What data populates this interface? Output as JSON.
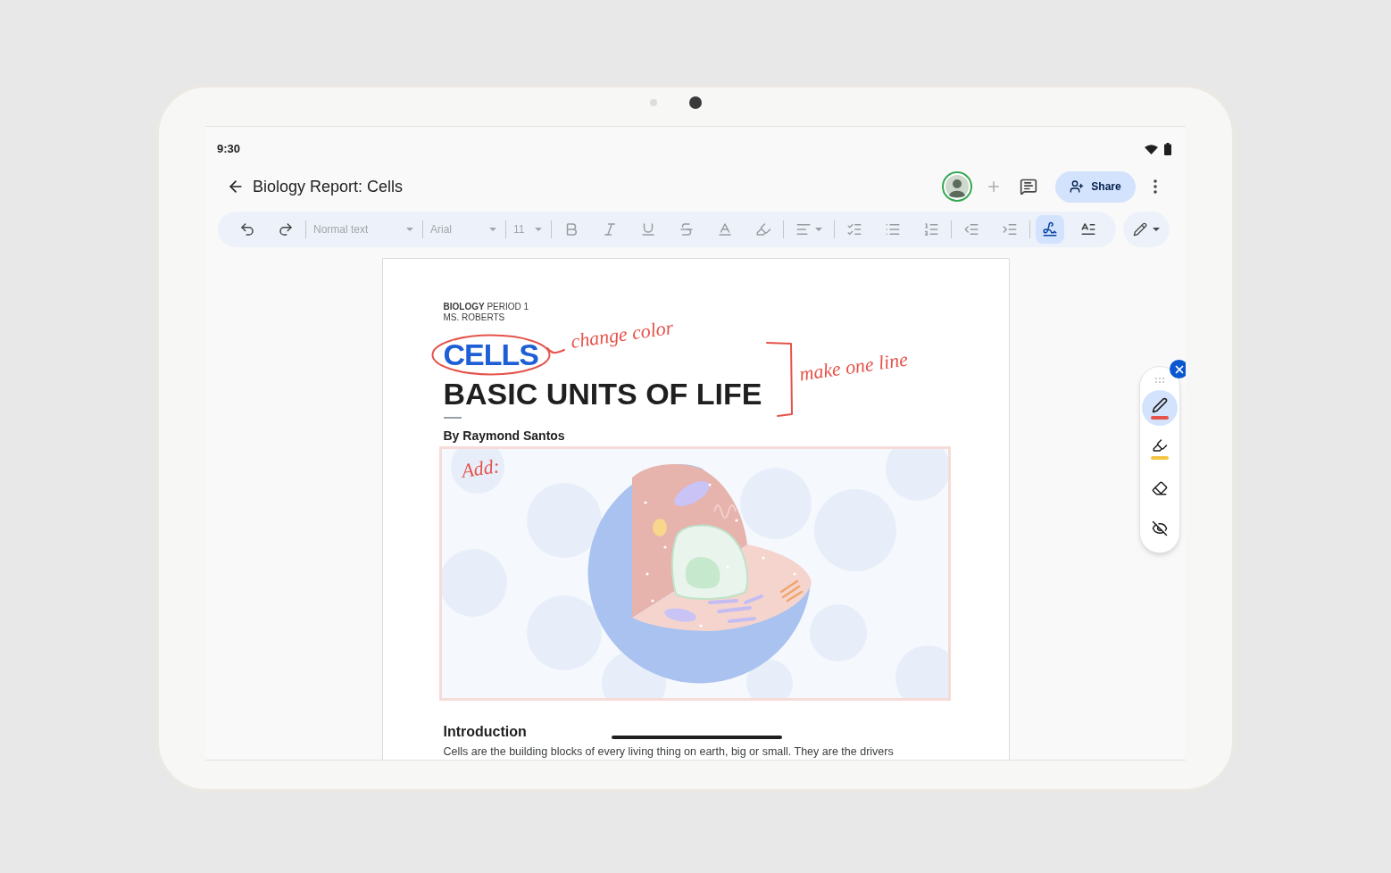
{
  "status_bar": {
    "time": "9:30"
  },
  "app_bar": {
    "title": "Biology Report: Cells",
    "share": "Share"
  },
  "toolbar": {
    "groups": [
      [
        {
          "kind": "undo",
          "disabled": false
        },
        {
          "kind": "redo",
          "disabled": false
        }
      ],
      [
        {
          "kind": "dropdown",
          "label": "Normal text",
          "disabled": true
        }
      ],
      [
        {
          "kind": "dropdown",
          "label": "Arial",
          "disabled": true
        }
      ],
      [
        {
          "kind": "dropdown",
          "label": "11",
          "disabled": true
        }
      ],
      [
        {
          "kind": "bold",
          "disabled": true
        },
        {
          "kind": "italic",
          "disabled": true
        },
        {
          "kind": "underline",
          "disabled": true
        },
        {
          "kind": "strikethrough",
          "disabled": true
        },
        {
          "kind": "text_color",
          "disabled": true
        },
        {
          "kind": "highlight",
          "disabled": true
        }
      ],
      [
        {
          "kind": "align",
          "disabled": true
        }
      ],
      [
        {
          "kind": "checklist",
          "disabled": true
        },
        {
          "kind": "bullets",
          "disabled": true
        },
        {
          "kind": "numbered",
          "disabled": true
        }
      ],
      [
        {
          "kind": "outdent",
          "disabled": true
        },
        {
          "kind": "indent",
          "disabled": true
        }
      ],
      [
        {
          "kind": "handwriting",
          "selected": true
        },
        {
          "kind": "text_format",
          "selected": false
        }
      ]
    ]
  },
  "document": {
    "course": "**BIOLOGY** PERIOD 1",
    "teacher": "MS. ROBERTS",
    "title": "CELLS",
    "subtitle": "BASIC UNITS OF LIFE",
    "byline": "By Raymond Santos",
    "heading": "Introduction",
    "body": "Cells are the building blocks of every living thing on earth, big or small. They are the drivers"
  },
  "annotations": [
    {
      "kind": "circled",
      "text": "change color"
    },
    {
      "kind": "bracketed",
      "text": "make one line"
    },
    {
      "kind": "note",
      "text": "Add:"
    }
  ],
  "pen_palette": {
    "tools": [
      {
        "kind": "pen",
        "selected": true,
        "color": "#e5534b"
      },
      {
        "kind": "highlighter",
        "selected": false,
        "color": "#f4c542"
      },
      {
        "kind": "eraser",
        "selected": false
      },
      {
        "kind": "hide",
        "selected": false
      }
    ]
  }
}
